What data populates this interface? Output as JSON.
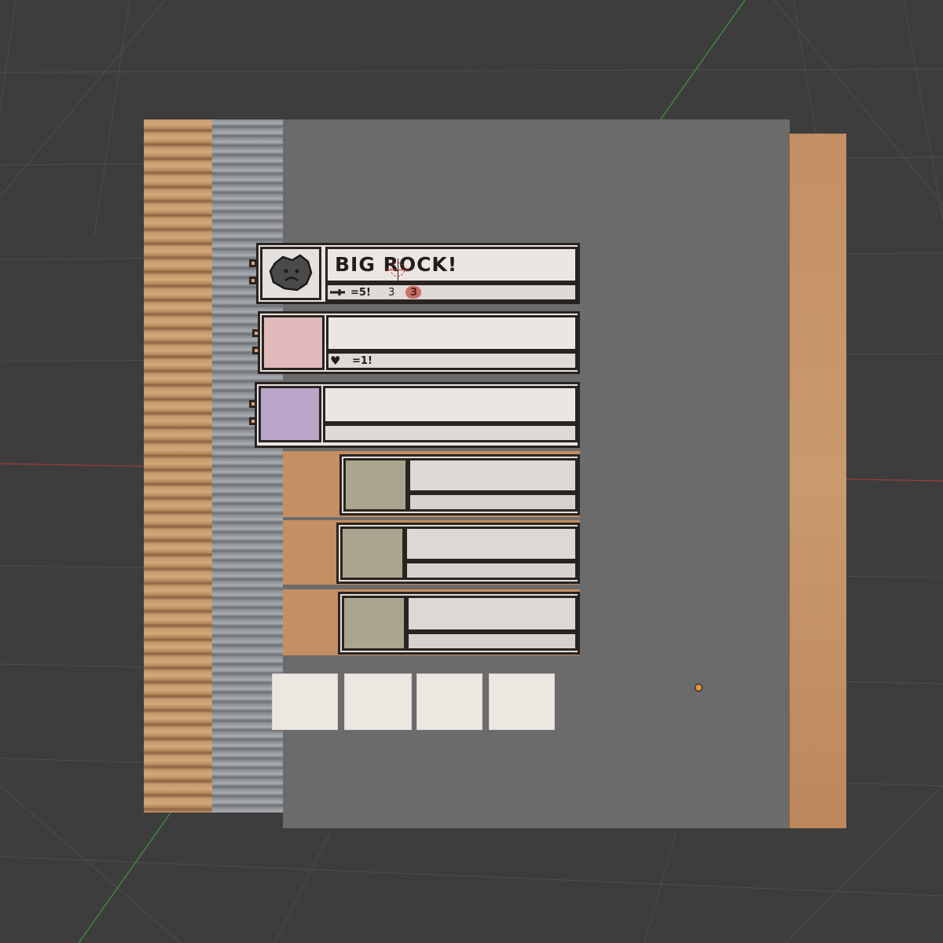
{
  "scene": {
    "background_color": "#3d3d3d",
    "x_axis_color": "#a33a3a",
    "y_axis_color": "#3a9a3a",
    "cardboard_color": "#c79a6d",
    "panel_color": "#6b6b6b",
    "paper_color": "#e9e4df",
    "ink_color": "#2a2421"
  },
  "enemy_card": {
    "title": "BIG ROCK!",
    "portrait_icon": "sad-rock-icon",
    "stats": {
      "attack_icon": "sword-icon",
      "attack_text": "=5!",
      "stat_a": "3",
      "stat_b": "3"
    }
  },
  "ability_cards": [
    {
      "color": "#e0b9bb",
      "icon": "heart-icon",
      "stat_text": "=1!"
    },
    {
      "color": "#b9a6c9",
      "icon": "",
      "stat_text": ""
    }
  ],
  "item_cards": [
    {
      "color": "#aaa58e"
    },
    {
      "color": "#aaa58e"
    },
    {
      "color": "#aaa58e"
    }
  ],
  "inventory_slots": [
    "",
    "",
    "",
    ""
  ]
}
